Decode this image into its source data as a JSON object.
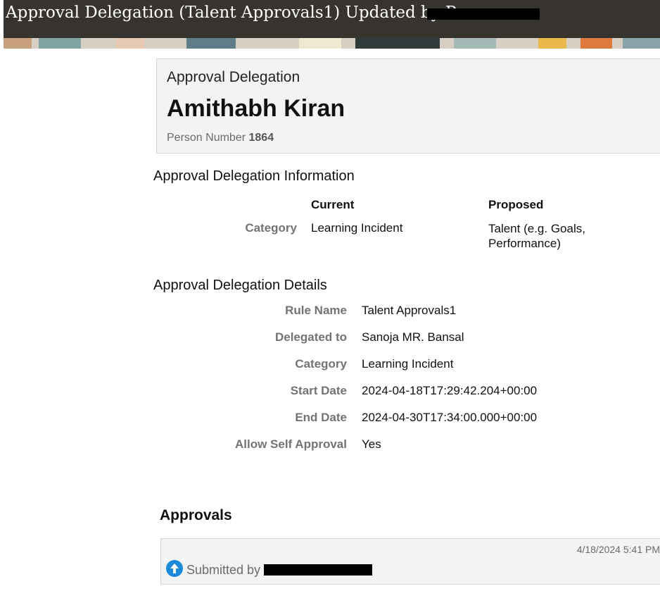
{
  "header": {
    "title": "Approval Delegation (Talent Approvals1) Updated by Pa"
  },
  "card": {
    "label": "Approval Delegation",
    "name": "Amithabh Kiran",
    "person_number_label": "Person Number",
    "person_number": "1864"
  },
  "info": {
    "title": "Approval Delegation Information",
    "current_header": "Current",
    "proposed_header": "Proposed",
    "row_label": "Category",
    "current_value": "Learning Incident",
    "proposed_value_line1": "Talent (e.g. Goals,",
    "proposed_value_line2": "Performance)"
  },
  "details": {
    "title": "Approval Delegation Details",
    "rows": [
      {
        "label": "Rule Name",
        "value": "Talent Approvals1"
      },
      {
        "label": "Delegated to",
        "value": "Sanoja MR. Bansal"
      },
      {
        "label": "Category",
        "value": "Learning Incident"
      },
      {
        "label": "Start Date",
        "value": "2024-04-18T17:29:42.204+00:00"
      },
      {
        "label": "End Date",
        "value": "2024-04-30T17:34:00.000+00:00"
      },
      {
        "label": "Allow Self Approval",
        "value": "Yes"
      }
    ]
  },
  "approvals": {
    "title": "Approvals",
    "timestamp": "4/18/2024 5:41 PM",
    "submitted_by": "Submitted by",
    "icon": "arrow-up-circle-icon"
  },
  "colors": {
    "header_bg": "#37332f",
    "card_bg": "#f3f3f3",
    "label_gray": "#737373",
    "icon_blue": "#1b8ad8"
  }
}
